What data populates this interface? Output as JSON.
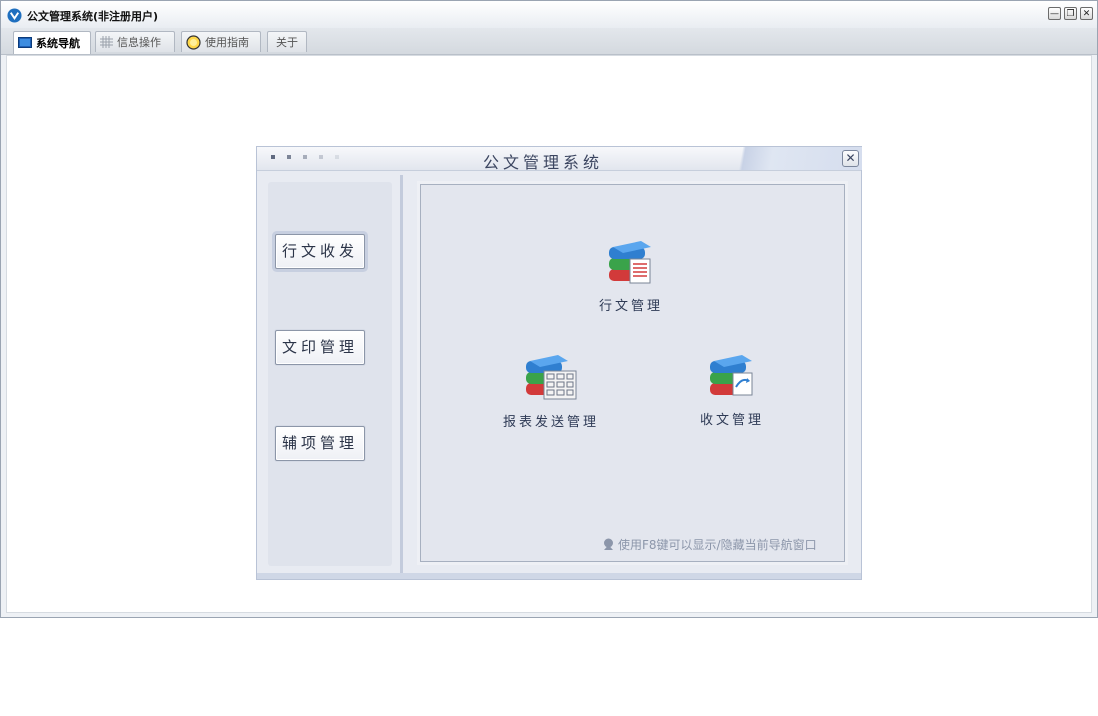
{
  "window": {
    "title": "公文管理系统(非注册用户)",
    "controls": [
      "minimize",
      "restore",
      "close"
    ]
  },
  "tabs": [
    {
      "label": "系统导航",
      "icon": "monitor-icon",
      "active": true
    },
    {
      "label": "信息操作",
      "icon": "grid-icon",
      "active": false
    },
    {
      "label": "使用指南",
      "icon": "help-circle-icon",
      "active": false
    },
    {
      "label": "关于",
      "icon": "",
      "active": false
    }
  ],
  "nav": {
    "title": "公文管理系统",
    "sidebar": [
      {
        "label": "行文收发"
      },
      {
        "label": "文印管理"
      },
      {
        "label": "辅项管理"
      }
    ],
    "modules": [
      {
        "label": "行文管理",
        "icon": "book-document-icon"
      },
      {
        "label": "报表发送管理",
        "icon": "book-report-icon"
      },
      {
        "label": "收文管理",
        "icon": "book-receive-icon"
      }
    ],
    "tip": "使用F8键可以显示/隐藏当前导航窗口"
  },
  "colors": {
    "accent": "#3b4560",
    "panel_bg": "#e3e6ee",
    "book_blue": "#2f7fd0",
    "book_green": "#3aa34a",
    "book_red": "#d23a3a"
  }
}
